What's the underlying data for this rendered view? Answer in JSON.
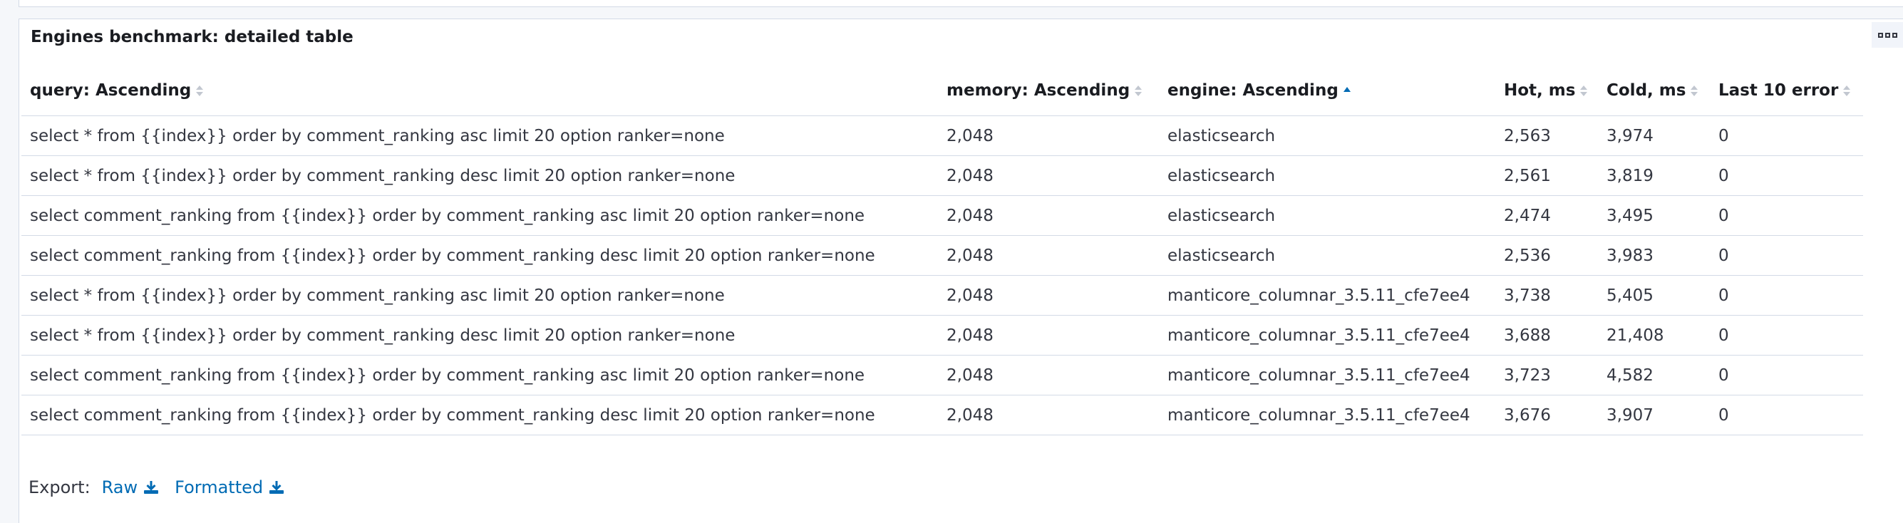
{
  "panel": {
    "title": "Engines benchmark: detailed table"
  },
  "table": {
    "columns": [
      {
        "label": "query: Ascending",
        "sort": "none"
      },
      {
        "label": "memory: Ascending",
        "sort": "none"
      },
      {
        "label": "engine: Ascending",
        "sort": "asc"
      },
      {
        "label": "Hot, ms",
        "sort": "none"
      },
      {
        "label": "Cold, ms",
        "sort": "none"
      },
      {
        "label": "Last 10 error",
        "sort": "none"
      }
    ],
    "rows": [
      [
        "select * from {{index}} order by comment_ranking asc limit 20 option ranker=none",
        "2,048",
        "elasticsearch",
        "2,563",
        "3,974",
        "0"
      ],
      [
        "select * from {{index}} order by comment_ranking desc limit 20 option ranker=none",
        "2,048",
        "elasticsearch",
        "2,561",
        "3,819",
        "0"
      ],
      [
        "select comment_ranking from {{index}} order by comment_ranking asc limit 20 option ranker=none",
        "2,048",
        "elasticsearch",
        "2,474",
        "3,495",
        "0"
      ],
      [
        "select comment_ranking from {{index}} order by comment_ranking desc limit 20 option ranker=none",
        "2,048",
        "elasticsearch",
        "2,536",
        "3,983",
        "0"
      ],
      [
        "select * from {{index}} order by comment_ranking asc limit 20 option ranker=none",
        "2,048",
        "manticore_columnar_3.5.11_cfe7ee4",
        "3,738",
        "5,405",
        "0"
      ],
      [
        "select * from {{index}} order by comment_ranking desc limit 20 option ranker=none",
        "2,048",
        "manticore_columnar_3.5.11_cfe7ee4",
        "3,688",
        "21,408",
        "0"
      ],
      [
        "select comment_ranking from {{index}} order by comment_ranking asc limit 20 option ranker=none",
        "2,048",
        "manticore_columnar_3.5.11_cfe7ee4",
        "3,723",
        "4,582",
        "0"
      ],
      [
        "select comment_ranking from {{index}} order by comment_ranking desc limit 20 option ranker=none",
        "2,048",
        "manticore_columnar_3.5.11_cfe7ee4",
        "3,676",
        "3,907",
        "0"
      ]
    ]
  },
  "export": {
    "label": "Export:",
    "raw_label": "Raw",
    "formatted_label": "Formatted"
  },
  "colors": {
    "link": "#006bb4",
    "border": "#d3dae6",
    "text": "#343741"
  },
  "icons": {
    "options": "options-icon",
    "sort": "sort-icon",
    "download": "download-icon"
  }
}
